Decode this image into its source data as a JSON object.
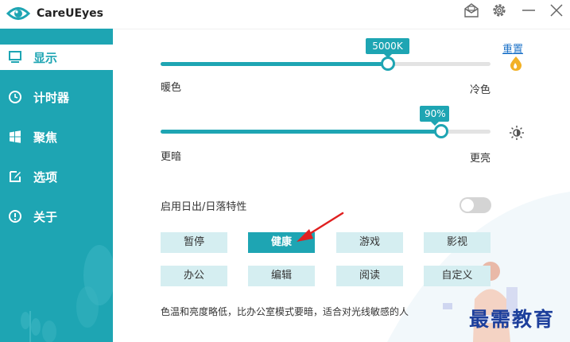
{
  "app": {
    "title": "CareUEyes"
  },
  "titlebar_icons": [
    "mail-icon",
    "gear-icon",
    "minimize-icon",
    "close-icon"
  ],
  "sidebar": {
    "items": [
      {
        "label": "显示",
        "icon": "monitor-icon",
        "active": true
      },
      {
        "label": "计时器",
        "icon": "clock-icon",
        "active": false
      },
      {
        "label": "聚焦",
        "icon": "windows-icon",
        "active": false
      },
      {
        "label": "选项",
        "icon": "edit-icon",
        "active": false
      },
      {
        "label": "关于",
        "icon": "info-icon",
        "active": false
      }
    ]
  },
  "color_temp": {
    "value_label": "5000K",
    "level": 0.69,
    "min_label": "暖色",
    "max_label": "冷色",
    "reset_label": "重置"
  },
  "brightness": {
    "value_label": "90%",
    "level": 0.85,
    "min_label": "更暗",
    "max_label": "更亮"
  },
  "sunrise": {
    "label": "启用日出/日落特性",
    "enabled": false
  },
  "modes": [
    {
      "label": "暂停",
      "active": false
    },
    {
      "label": "健康",
      "active": true
    },
    {
      "label": "游戏",
      "active": false
    },
    {
      "label": "影视",
      "active": false
    },
    {
      "label": "办公",
      "active": false
    },
    {
      "label": "编辑",
      "active": false
    },
    {
      "label": "阅读",
      "active": false
    },
    {
      "label": "自定义",
      "active": false
    }
  ],
  "description": "色温和亮度略低，比办公室模式要暗，适合对光线敏感的人",
  "watermark": "最需教育",
  "colors": {
    "accent": "#1ea5b3",
    "mode_bg": "#d5eef1",
    "link": "#1e73c8",
    "arrow": "#e02020"
  }
}
